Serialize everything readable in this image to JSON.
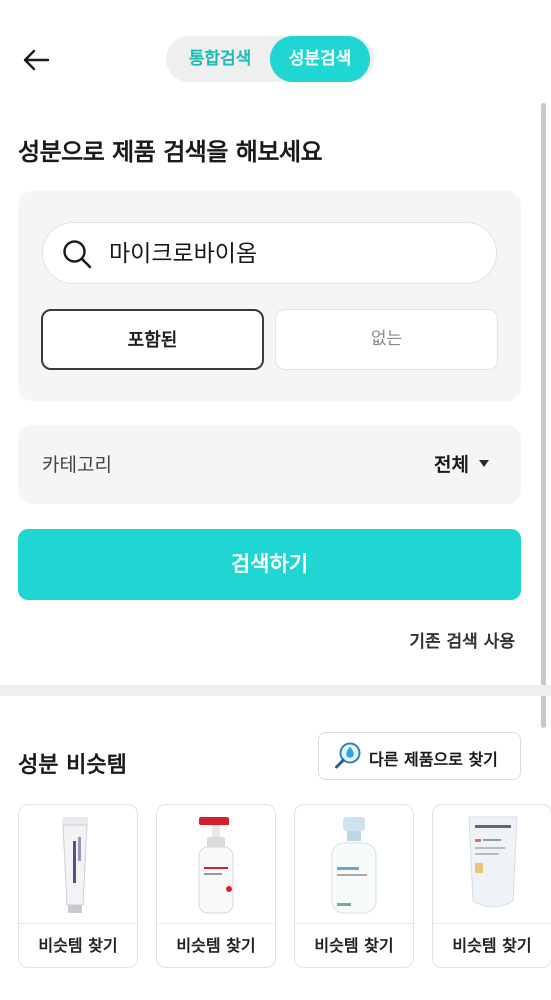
{
  "header": {
    "back_icon": "arrow-left-icon",
    "tabs": [
      {
        "label": "통합검색",
        "active": false
      },
      {
        "label": "성분검색",
        "active": true
      }
    ]
  },
  "page_title": "성분으로 제품 검색을 해보세요",
  "search": {
    "icon": "search-icon",
    "value": "마이크로바이옴"
  },
  "filters": {
    "include_label": "포함된",
    "exclude_label": "없는",
    "selected": "포함된"
  },
  "category": {
    "label": "카테고리",
    "value": "전체",
    "icon": "caret-down-icon"
  },
  "search_button": "검색하기",
  "previous_search_link": "기존 검색 사용",
  "similar_items": {
    "title": "성분 비슷템",
    "other_button_label": "다른 제품으로 찾기",
    "other_button_icon": "drop-magnifier-icon",
    "cards": [
      {
        "label": "비슷템 찾기",
        "product_icon": "tube-product-icon"
      },
      {
        "label": "비슷템 찾기",
        "product_icon": "pump-bottle-red-icon"
      },
      {
        "label": "비슷템 찾기",
        "product_icon": "pump-bottle-blue-icon"
      },
      {
        "label": "비슷템 찾기",
        "product_icon": "sunscreen-tube-icon"
      }
    ]
  },
  "colors": {
    "accent": "#1fd6d2",
    "accent_text": "#19bcb6",
    "panel_bg": "#f5f5f5"
  }
}
